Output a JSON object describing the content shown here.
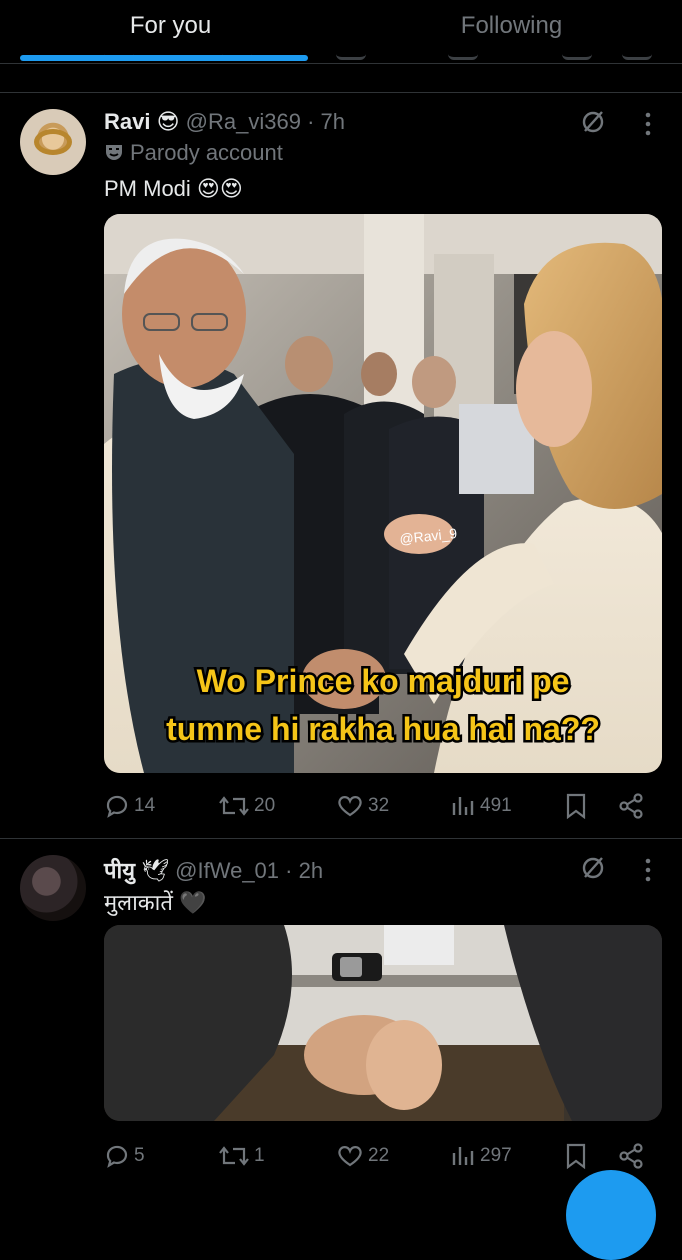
{
  "tabs": [
    {
      "label": "For you",
      "active": true
    },
    {
      "label": "Following",
      "active": false
    }
  ],
  "accent_color": "#1d9bf0",
  "tweets": [
    {
      "name": "Ravi",
      "name_emoji": "😎",
      "handle": "@Ra_vi369",
      "time": "· 7h",
      "badge_icon": "theater-mask-icon",
      "badge_text": "Parody account",
      "text": "PM Modi",
      "text_emoji": "😍😍",
      "media": {
        "watermark": "@Ravi_9",
        "caption_line1": "Wo Prince ko majduri pe",
        "caption_line2": "tumne hi rakha hua hai na??"
      },
      "stats": {
        "replies": "14",
        "retweets": "20",
        "likes": "32",
        "views": "491"
      }
    },
    {
      "name": "पीयु",
      "name_emoji": "🕊",
      "handle": "@IfWe_01",
      "time": "· 2h",
      "text": "मुलाकातें",
      "text_emoji": "🖤",
      "stats": {
        "replies": "5",
        "retweets": "1",
        "likes": "22",
        "views": "297"
      }
    }
  ]
}
